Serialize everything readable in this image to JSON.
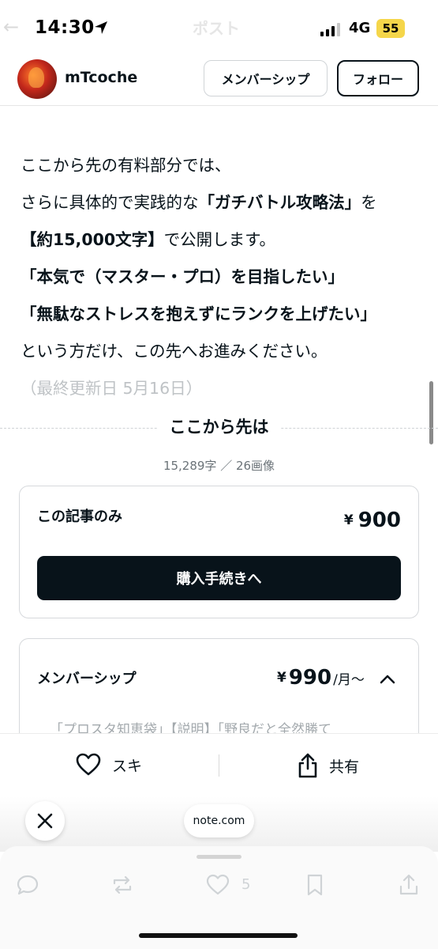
{
  "status_bar": {
    "time": "14:30",
    "network": "4G",
    "battery": "55",
    "background_title": "ポスト",
    "background_back": "←"
  },
  "header": {
    "author": "mTcoche",
    "membership_label": "メンバーシップ",
    "follow_label": "フォロー"
  },
  "article": {
    "lines": [
      {
        "parts": [
          {
            "text": "ここから先の有料部分では、",
            "bold": false
          }
        ]
      },
      {
        "parts": [
          {
            "text": "さらに具体的で実践的な",
            "bold": false
          },
          {
            "text": "「ガチバトル攻略法」",
            "bold": true
          },
          {
            "text": "を",
            "bold": false
          }
        ]
      },
      {
        "parts": [
          {
            "text": "【約15,000文字】",
            "bold": true
          },
          {
            "text": "で公開します。",
            "bold": false
          }
        ]
      },
      {
        "parts": [
          {
            "text": "「本気で（マスター・プロ）を目指したい」",
            "bold": true
          }
        ]
      },
      {
        "parts": [
          {
            "text": "「無駄なストレスを抱えずにランクを上げたい」",
            "bold": true
          }
        ]
      },
      {
        "parts": [
          {
            "text": "という方だけ、この先へお進みください。",
            "bold": false
          }
        ]
      },
      {
        "parts": [
          {
            "text": "（最終更新日 5月16日）",
            "bold": false
          }
        ],
        "faded": true
      }
    ]
  },
  "paywall": {
    "divider_label": "ここから先は",
    "counts": "15,289字 ／ 26画像",
    "single": {
      "title": "この記事のみ",
      "currency": "¥",
      "price": "900",
      "button_label": "購入手続きへ"
    },
    "membership": {
      "title": "メンバーシップ",
      "currency": "¥",
      "price": "990",
      "unit": "/月〜",
      "description": "「プロスタ知恵袋」【説明】「野良だと全然勝て"
    }
  },
  "actions": {
    "like_label": "スキ",
    "share_label": "共有"
  },
  "browser": {
    "url": "note.com"
  },
  "tweet_actions": {
    "like_count": "5"
  },
  "colors": {
    "text": "#08131a",
    "button_dark": "#08131a",
    "battery": "#f5d64a",
    "muted": "#6b7378"
  }
}
